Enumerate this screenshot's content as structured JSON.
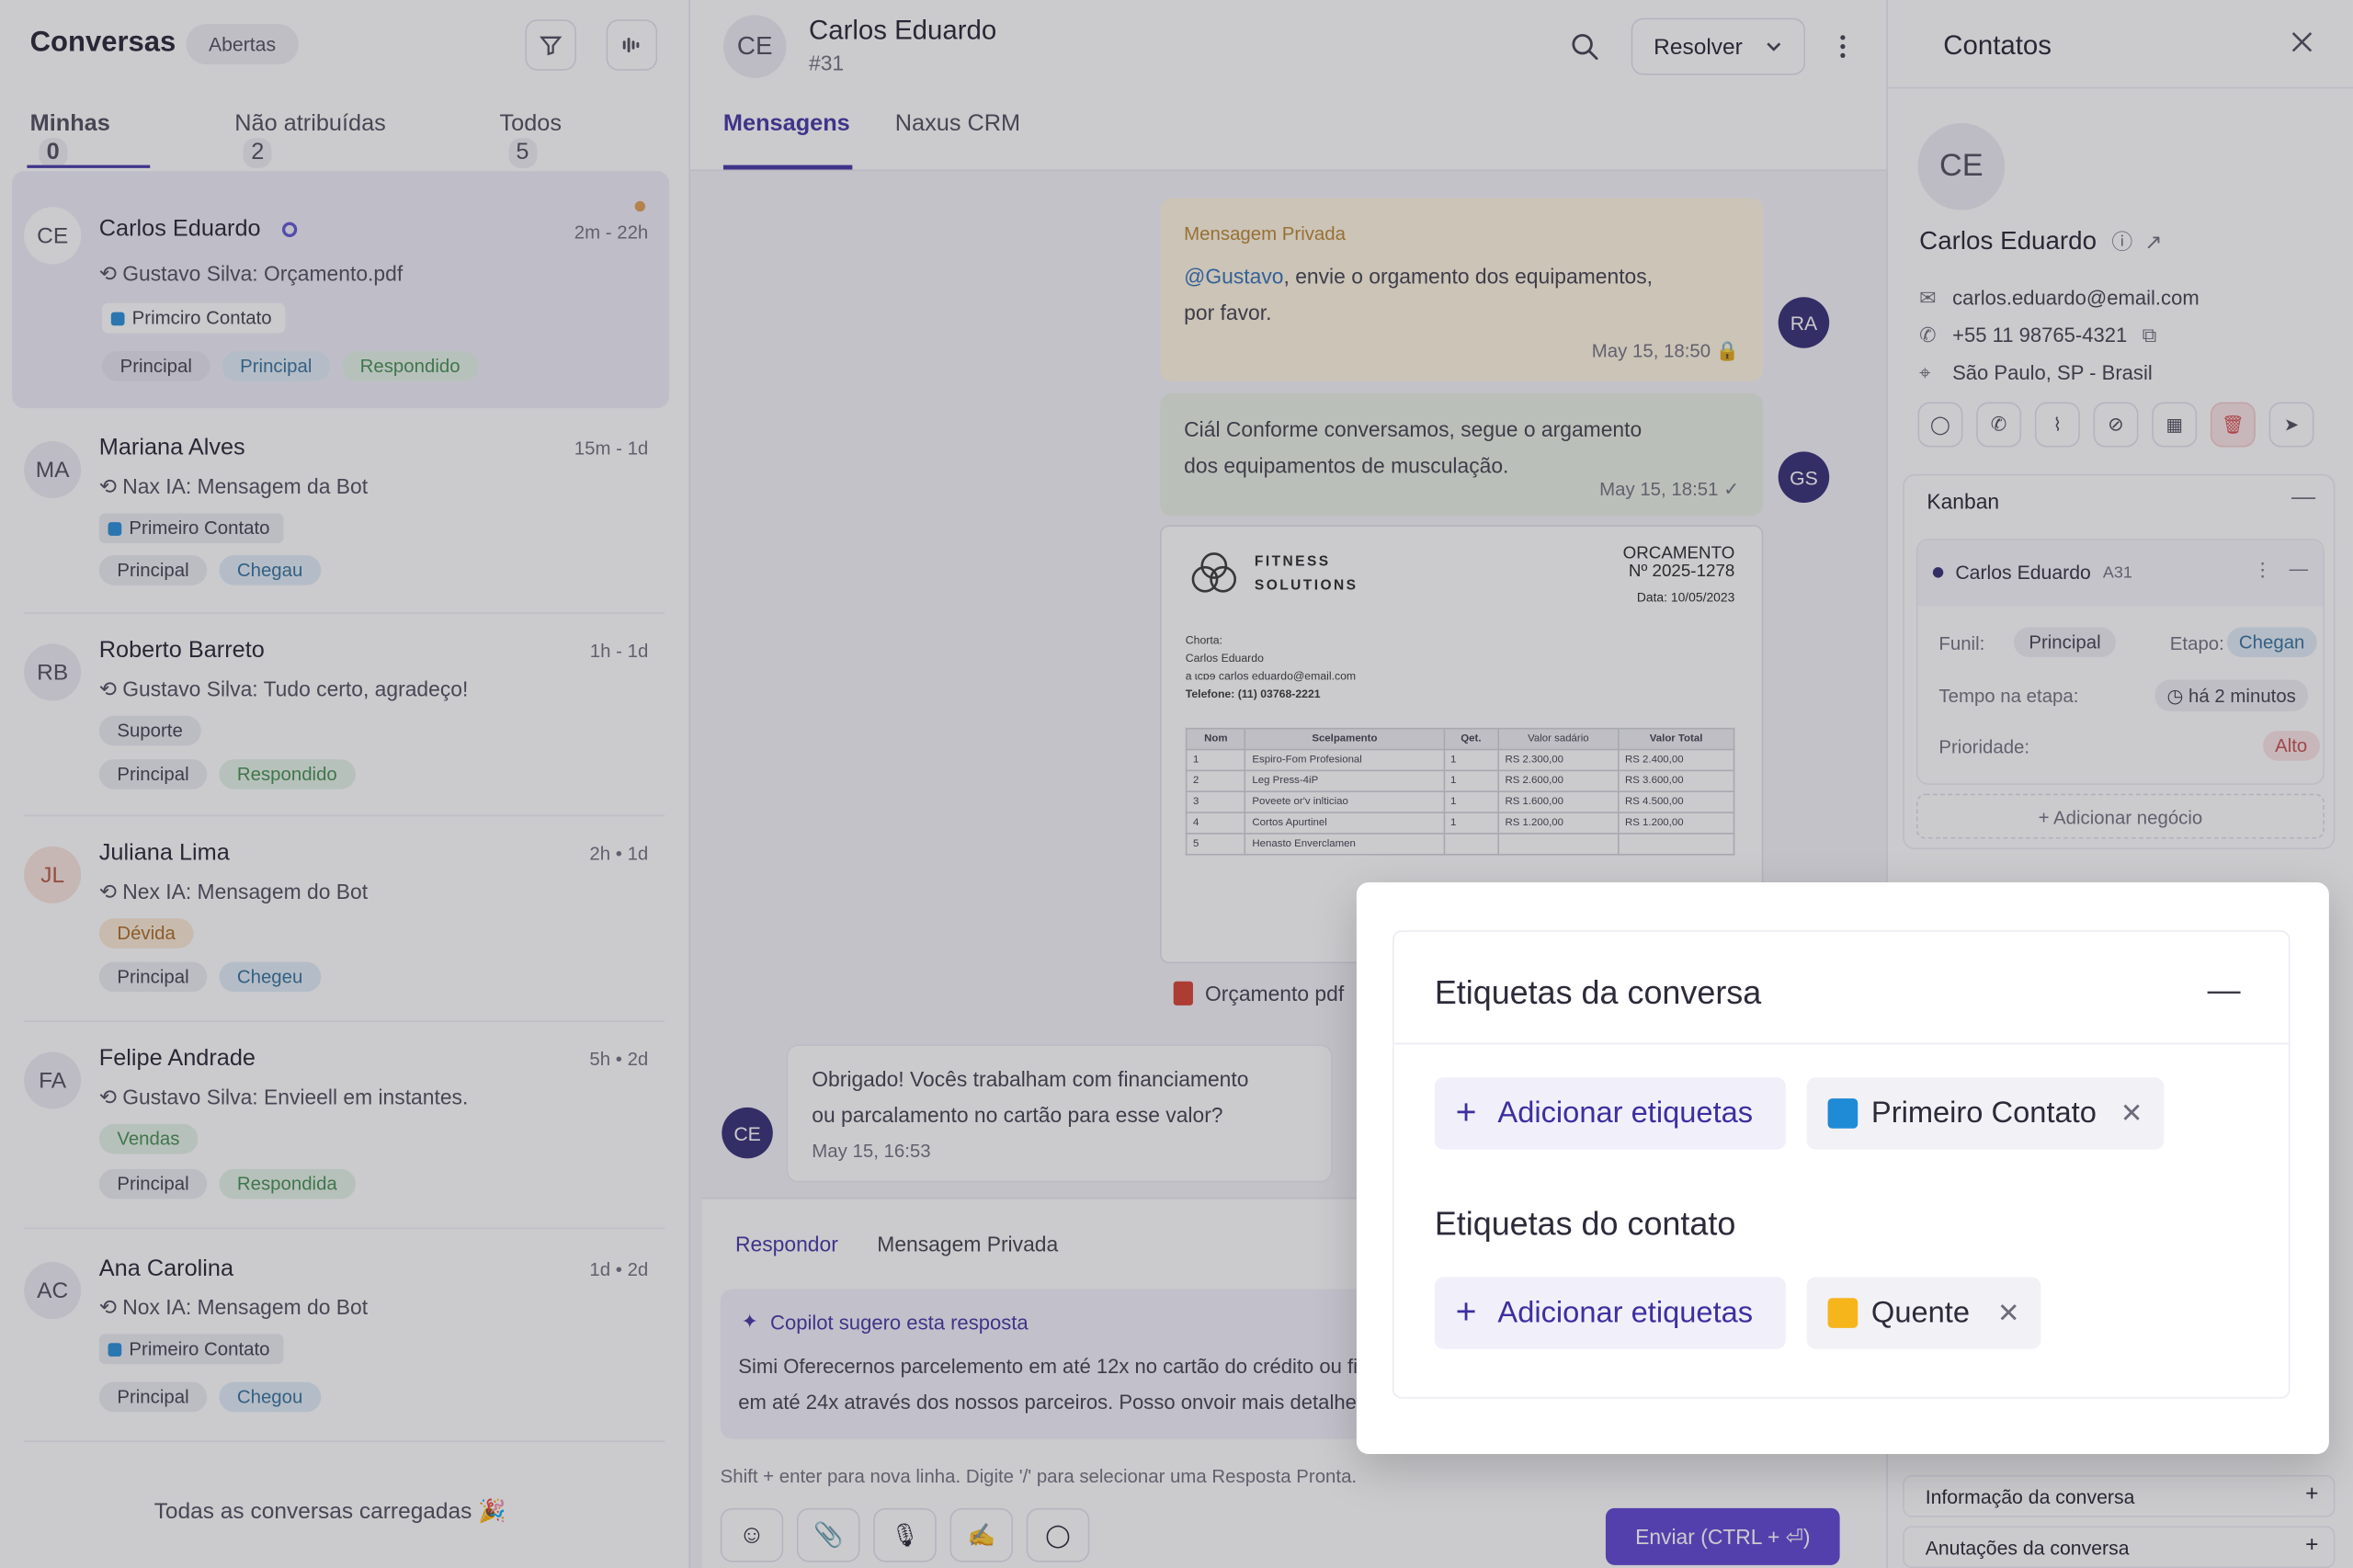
{
  "left": {
    "title": "Conversas",
    "status_filter": "Abertas",
    "tabs": [
      {
        "label": "Minhas",
        "count": "0"
      },
      {
        "label": "Não atribuídas",
        "count": "2"
      },
      {
        "label": "Todos",
        "count": "5"
      }
    ],
    "conversations": [
      {
        "initials": "CE",
        "name": "Carlos Eduardo",
        "time": "2m - 22h",
        "preview": "Gustavo Silva: Orçamento.pdf",
        "label": "Primciro Contato",
        "chips": [
          "Principal",
          "Principal",
          "Respondido"
        ]
      },
      {
        "initials": "MA",
        "name": "Mariana Alves",
        "time": "15m - 1d",
        "preview": "Nax IA: Mensagem da Bot",
        "label": "Primeiro Contato",
        "chips": [
          "Principal",
          "Chegau"
        ]
      },
      {
        "initials": "RB",
        "name": "Roberto Barreto",
        "time": "1h - 1d",
        "preview": "Gustavo Silva: Tudo certo, agradeço!",
        "label": "Suporte",
        "chips": [
          "Principal",
          "Respondido"
        ]
      },
      {
        "initials": "JL",
        "name": "Juliana Lima",
        "time": "2h • 1d",
        "preview": "Nex IA: Mensagem do Bot",
        "label": "Dévida",
        "chips": [
          "Principal",
          "Chegeu"
        ]
      },
      {
        "initials": "FA",
        "name": "Felipe Andrade",
        "time": "5h • 2d",
        "preview": "Gustavo Silva: Envieell em instantes.",
        "label": "Vendas",
        "chips": [
          "Principal",
          "Respondida"
        ]
      },
      {
        "initials": "AC",
        "name": "Ana Carolina",
        "time": "1d • 2d",
        "preview": "Nox IA: Mensagem do Bot",
        "label": "Primeiro Contato",
        "chips": [
          "Principal",
          "Chegou"
        ]
      }
    ],
    "footer": "Todas as conversas carregadas 🎉"
  },
  "middle": {
    "contact_initials": "CE",
    "contact_name": "Carlos Eduardo",
    "conversation_id": "#31",
    "resolve_label": "Resolver",
    "tabs": [
      "Mensagens",
      "Naxus CRM"
    ],
    "private_note": {
      "label": "Mensagem Privada",
      "mention": "@Gustavo",
      "text_a": ", envie o orgamento dos equipamentos,",
      "text_b": "por favor.",
      "time": "May 15, 18:50",
      "avatar": "RA"
    },
    "reply": {
      "line1": "Ciál Conforme conversamos, segue o argamento",
      "line2": "dos equipamentos de musculação.",
      "time": "May 15, 18:51",
      "avatar": "GS"
    },
    "document": {
      "brand_line1": "FITNESS",
      "brand_line2": "SOLUTIONS",
      "doc_title": "ORCAMENTO",
      "doc_number": "Nº 2025-1278",
      "doc_date": "Data: 10/05/2023",
      "client_lines": [
        "Chorta:",
        "Carlos Eduardo",
        "a ɩcɒɘ carlos eduardo@email.com",
        "Telefone: (11) 03768-2221"
      ],
      "headers": [
        "Nom",
        "Scelpamento",
        "Qet.",
        "Valor sadário",
        "Valor Total"
      ],
      "rows": [
        [
          "1",
          "Espiro-Fom Profesional",
          "1",
          "RS 2.300,00",
          "RS 2.400,00"
        ],
        [
          "2",
          "Leg Press-4iP",
          "1",
          "RS 2.600,00",
          "RS 3.600,00"
        ],
        [
          "3",
          "Poveete or'v inlticiao",
          "1",
          "RS 1.600,00",
          "RS 4.500,00"
        ],
        [
          "4",
          "Cortos Apurtinel",
          "1",
          "RS 1.200,00",
          "RS 1.200,00"
        ],
        [
          "5",
          "Henasto Enverclamen",
          "",
          "",
          ""
        ]
      ],
      "file_name": "Orçamento pdf"
    },
    "incoming": {
      "line1": "Obrigado! Vocês trabalham com financiamento",
      "line2": "ou parcalamento no cartão para esse valor?",
      "time": "May 15, 16:53",
      "avatar": "CE"
    },
    "composer": {
      "tabs": [
        "Respondor",
        "Mensagem Privada"
      ],
      "copilot_title": "Copilot sugero esta resposta",
      "copilot_line1": "Simi Oferecernos parcelemento em até 12x no cartão do crédito ou fi",
      "copilot_line2": "em até 24x através dos nossos parceiros. Posso onvoir mais detalhes",
      "hint": "Shift + enter para nova linha. Digite '/' para selecionar uma Resposta Pronta.",
      "send_label": "Enviar (CTRL + ⏎)"
    }
  },
  "right": {
    "title": "Contatos",
    "initials": "CE",
    "name": "Carlos Eduardo",
    "email": "carlos.eduardo@email.com",
    "phone": "+55 11 98765-4321",
    "location": "São Paulo, SP - Brasil",
    "kanban": {
      "title": "Kanban",
      "card_name": "Carlos Eduardo",
      "card_id": "A31",
      "funnel_label": "Funil:",
      "funnel_value": "Principal",
      "stage_label": "Etapo:",
      "stage_value": "Chegan",
      "time_label": "Tempo na etapa:",
      "time_value": "há 2 minutos",
      "priority_label": "Prioridade:",
      "priority_value": "Alto",
      "add_deal": "+ Adicionar negócio"
    },
    "sections": [
      "Informação da conversa",
      "Anutações da conversa"
    ]
  },
  "modal": {
    "title": "Etiquetas da conversa",
    "add_label": "Adicionar etiquetas",
    "conversation_tag": {
      "name": "Primeiro Contato",
      "color": "#1f8ad6"
    },
    "contact_title": "Etiquetas do contato",
    "contact_tag": {
      "name": "Quente",
      "color": "#f7b51c"
    }
  }
}
